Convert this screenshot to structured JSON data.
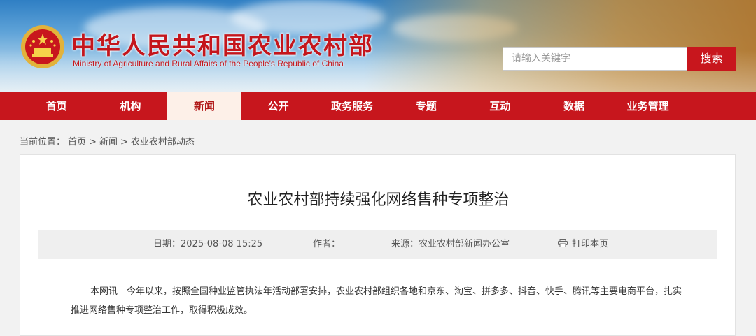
{
  "header": {
    "title": "中华人民共和国农业农村部",
    "subtitle": "Ministry of Agriculture and Rural Affairs of the People's Republic of China",
    "search_placeholder": "请输入关键字",
    "search_button": "搜索"
  },
  "nav": {
    "items": [
      {
        "label": "首页"
      },
      {
        "label": "机构"
      },
      {
        "label": "新闻"
      },
      {
        "label": "公开"
      },
      {
        "label": "政务服务"
      },
      {
        "label": "专题"
      },
      {
        "label": "互动"
      },
      {
        "label": "数据"
      },
      {
        "label": "业务管理"
      }
    ],
    "active_index": 2
  },
  "breadcrumb": {
    "label": "当前位置：",
    "items": [
      "首页",
      "新闻",
      "农业农村部动态"
    ],
    "separator": ">"
  },
  "article": {
    "title": "农业农村部持续强化网络售种专项整治",
    "date": "日期：2025-08-08 15:25",
    "author": "作者：",
    "source": "来源：农业农村部新闻办公室",
    "print_label": "打印本页",
    "body": "本网讯　今年以来，按照全国种业监管执法年活动部署安排，农业农村部组织各地和京东、淘宝、拼多多、抖音、快手、腾讯等主要电商平台，扎实推进网络售种专项整治工作，取得积极成效。"
  },
  "colors": {
    "brand_red": "#c7161d",
    "nav_active_bg": "#fdf0e8",
    "meta_bg": "#efefef"
  }
}
